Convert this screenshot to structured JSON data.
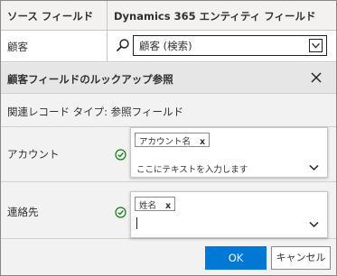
{
  "header": {
    "source_field_label": "ソース フィールド",
    "entity_field_label": "Dynamics 365 エンティティ フィールド"
  },
  "customer_row": {
    "source_label": "顧客",
    "selected_value": "顧客 (検索)",
    "search_icon": "search-icon",
    "dropdown_icon": "chevron-down-icon"
  },
  "lookup_panel": {
    "title": "顧客フィールドのルックアップ参照",
    "close_icon": "close-icon",
    "related_record_type": "関連レコード タイプ: 参照フィールド",
    "rows": [
      {
        "label": "アカウント",
        "status_icon": "check-circle-icon",
        "tag": "アカウント名",
        "tag_remove": "x",
        "input_placeholder": "ここにテキストを入力します"
      },
      {
        "label": "連絡先",
        "status_icon": "check-circle-icon",
        "tag": "姓名",
        "tag_remove": "x",
        "input_placeholder": ""
      }
    ]
  },
  "footer": {
    "ok_label": "OK",
    "cancel_label": "キャンセル"
  },
  "colors": {
    "primary": "#0078d4",
    "success": "#107c10",
    "border": "#c8c6c4"
  }
}
